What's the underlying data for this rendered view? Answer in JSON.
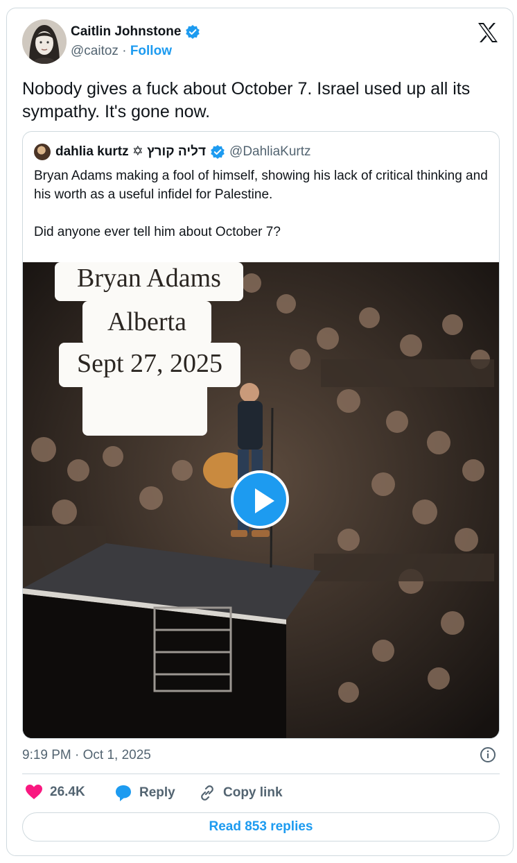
{
  "author": {
    "name": "Caitlin Johnstone",
    "handle": "@caitoz",
    "separator": "·",
    "follow_label": "Follow"
  },
  "tweet": {
    "text": "Nobody gives a fuck about October 7. Israel used up all its sympathy. It's gone now."
  },
  "quoted": {
    "name": "dahlia kurtz ✡ דליה קורץ",
    "handle": "@DahliaKurtz",
    "paragraph1": "Bryan Adams making a fool of himself, showing his lack of critical thinking and his worth as a useful infidel for Palestine.",
    "paragraph2": "Did anyone ever tell him about October 7?",
    "video_overlay": {
      "line1": "Bryan Adams",
      "line2": "Alberta",
      "line3": "Sept 27, 2025"
    }
  },
  "meta": {
    "timestamp": "9:19 PM · Oct 1, 2025"
  },
  "actions": {
    "likes": "26.4K",
    "reply_label": "Reply",
    "copy_label": "Copy link"
  },
  "footer": {
    "read_replies_label": "Read 853 replies"
  },
  "colors": {
    "accent": "#1d9bf0",
    "like": "#f91880",
    "secondary_text": "#536471",
    "border": "#cfd9de"
  },
  "icons": [
    "verified-badge-icon",
    "x-logo-icon",
    "play-icon",
    "info-icon",
    "heart-icon",
    "reply-bubble-icon",
    "link-icon"
  ]
}
